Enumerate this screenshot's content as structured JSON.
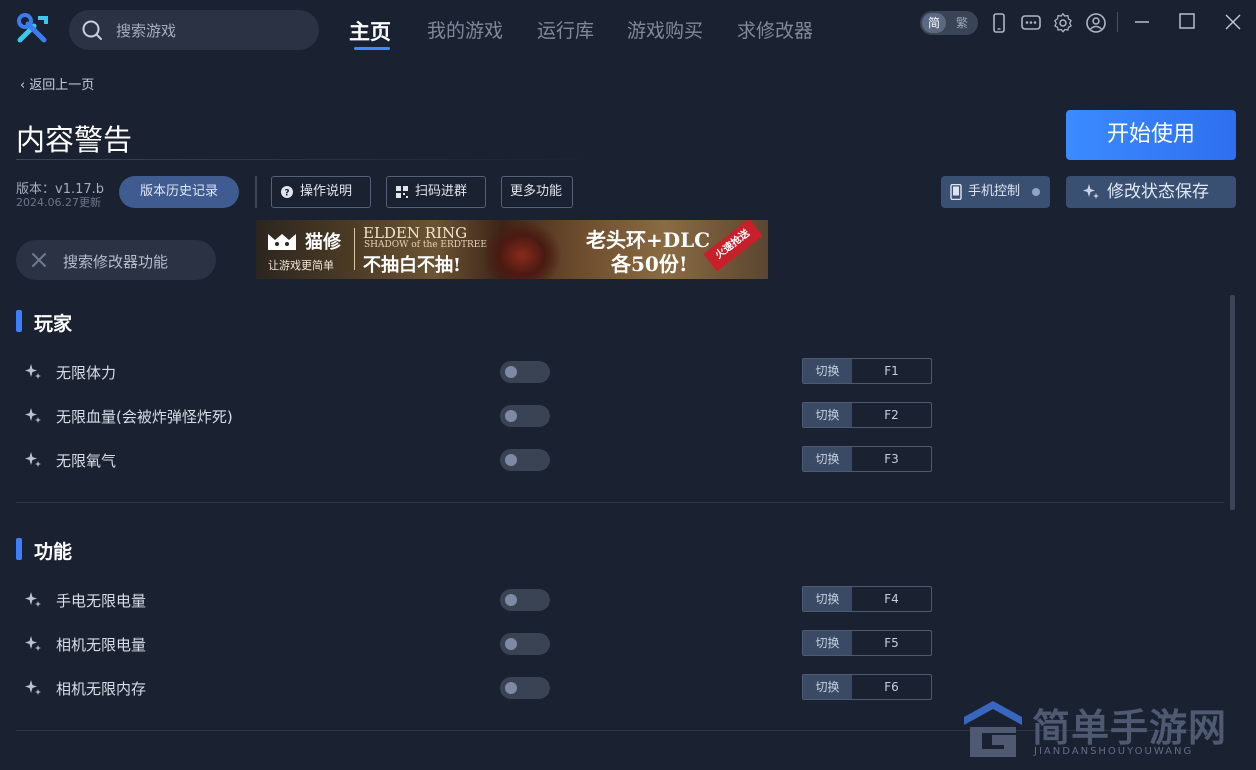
{
  "header": {
    "search_placeholder": "搜索游戏",
    "tabs": [
      {
        "label": "主页",
        "active": true
      },
      {
        "label": "我的游戏",
        "active": false
      },
      {
        "label": "运行库",
        "active": false
      },
      {
        "label": "游戏购买",
        "active": false
      },
      {
        "label": "求修改器",
        "active": false
      }
    ],
    "lang": {
      "simplified": "简",
      "traditional": "繁"
    },
    "accent": "#3d8bff"
  },
  "back_label": "返回上一页",
  "game_title": "内容警告",
  "start_button": "开始使用",
  "version": {
    "label": "版本：v1.17.b",
    "updated": "2024.06.27更新",
    "history_button": "版本历史记录"
  },
  "toolbar": {
    "instructions": "操作说明",
    "scan_join": "扫码进群",
    "more": "更多功能",
    "phone_control": "手机控制",
    "save_state": "修改状态保存"
  },
  "mod_search_placeholder": "搜索修改器功能",
  "banner": {
    "brand": "猫修",
    "slogan": "让游戏更简单",
    "game_line1": "ELDEN RING",
    "game_line2": "SHADOW of the ERDTREE",
    "tagline": "不抽白不抽!",
    "promo_line1": "老头环+DLC",
    "promo_line2": "各50份!",
    "ribbon": "火速抢送"
  },
  "sections": [
    {
      "title": "玩家",
      "items": [
        {
          "name": "无限体力",
          "switch_label": "切换",
          "key": "F1",
          "enabled": false
        },
        {
          "name": "无限血量(会被炸弹怪炸死)",
          "switch_label": "切换",
          "key": "F2",
          "enabled": false
        },
        {
          "name": "无限氧气",
          "switch_label": "切换",
          "key": "F3",
          "enabled": false
        }
      ]
    },
    {
      "title": "功能",
      "items": [
        {
          "name": "手电无限电量",
          "switch_label": "切换",
          "key": "F4",
          "enabled": false
        },
        {
          "name": "相机无限电量",
          "switch_label": "切换",
          "key": "F5",
          "enabled": false
        },
        {
          "name": "相机无限内存",
          "switch_label": "切换",
          "key": "F6",
          "enabled": false
        }
      ]
    }
  ],
  "watermark": {
    "cn": "简单手游网",
    "en": "JIANDANSHOUYOUWANG"
  }
}
